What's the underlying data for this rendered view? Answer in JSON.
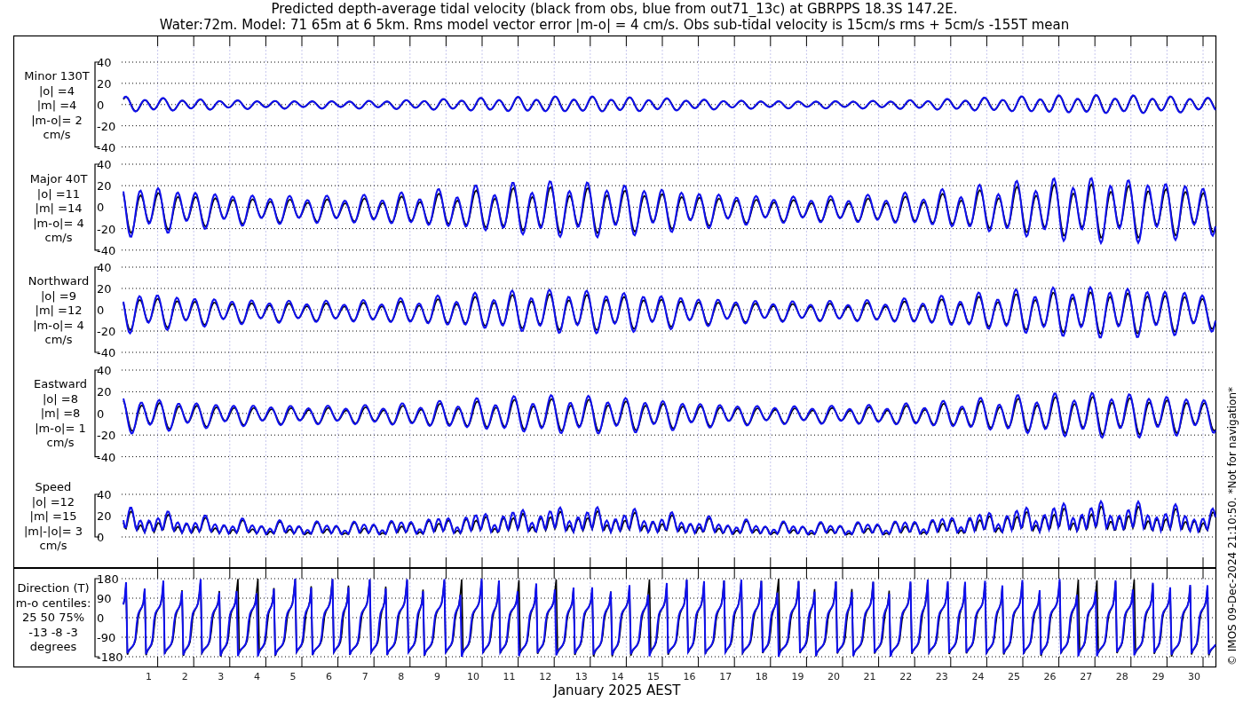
{
  "title": [
    "Predicted depth-average tidal velocity (black from obs, blue from out71_13c) at GBRPPS 18.3S 147.2E.",
    "Water:72m. Model: 71 65m at 6 5km. Rms model vector error |m-o| = 4 cm/s. Obs sub-tidal velocity is 15cm/s rms + 5cm/s -155T mean"
  ],
  "panels": [
    {
      "kind": "minor",
      "label": [
        "Minor 130T",
        "|o| =4",
        "|m| =4",
        "|m-o|= 2",
        "cm/s"
      ],
      "yticks": [
        "40",
        "20",
        "0",
        "-20",
        "-40"
      ]
    },
    {
      "kind": "major",
      "label": [
        "Major 40T",
        "|o| =11",
        "|m| =14",
        "|m-o|= 4",
        "cm/s"
      ],
      "yticks": [
        "40",
        "20",
        "0",
        "-20",
        "-40"
      ]
    },
    {
      "kind": "north",
      "label": [
        "Northward",
        "|o| =9",
        "|m| =12",
        "|m-o|= 4",
        "cm/s"
      ],
      "yticks": [
        "40",
        "20",
        "0",
        "-20",
        "-40"
      ]
    },
    {
      "kind": "east",
      "label": [
        "Eastward",
        "|o| =8",
        "|m| =8",
        "|m-o|= 1",
        "cm/s"
      ],
      "yticks": [
        "40",
        "20",
        "0",
        "-20",
        "-40"
      ]
    },
    {
      "kind": "speed",
      "label": [
        "Speed",
        "|o| =12",
        "|m| =15",
        "|m|-|o|= 3",
        "cm/s"
      ],
      "yticks": [
        "40",
        "20",
        "0"
      ]
    },
    {
      "kind": "direction",
      "label": [
        "Direction (T)",
        "m-o centiles:",
        "25  50  75%",
        "-13  -8  -3",
        "degrees"
      ],
      "yticks": [
        "180",
        "90",
        "0",
        "-90",
        "-180"
      ]
    }
  ],
  "days": [
    "1",
    "2",
    "3",
    "4",
    "5",
    "6",
    "7",
    "8",
    "9",
    "10",
    "11",
    "12",
    "13",
    "14",
    "15",
    "16",
    "17",
    "18",
    "19",
    "20",
    "21",
    "22",
    "23",
    "24",
    "25",
    "26",
    "27",
    "28",
    "29",
    "30"
  ],
  "xlabel": "January 2025 AEST",
  "footer": "© IMOS 09-Dec-2024 21:10:50. *Not for navigation*"
}
